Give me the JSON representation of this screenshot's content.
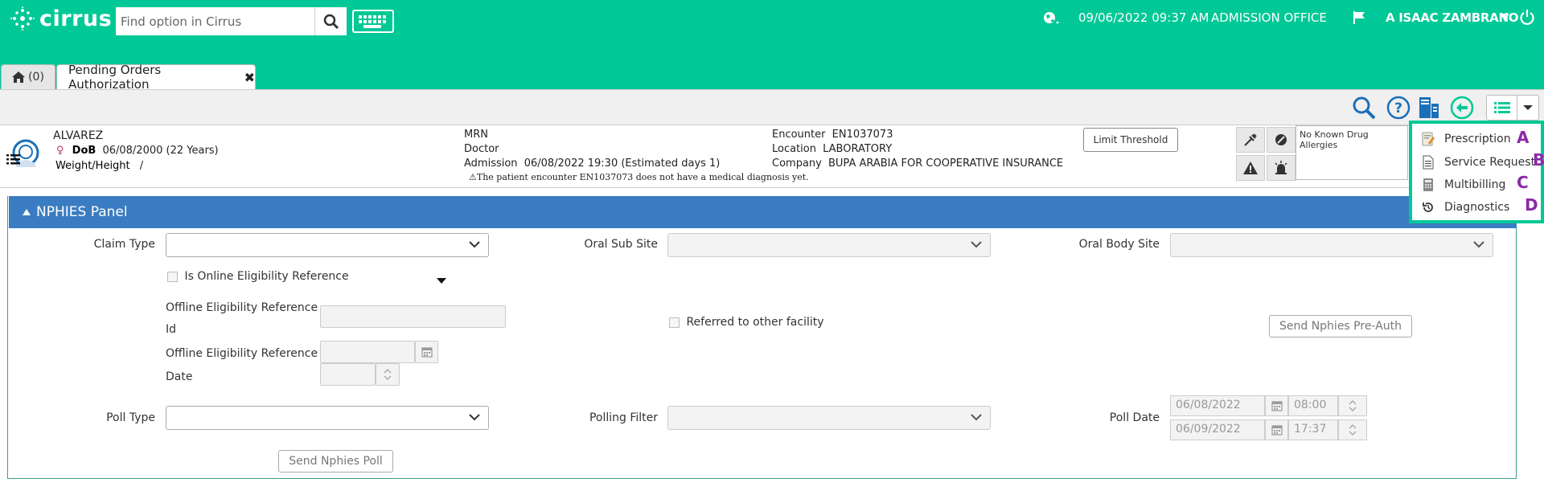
{
  "app": {
    "logo": "cirrus"
  },
  "header": {
    "search_placeholder": "Find option in Cirrus",
    "datetime": "09/06/2022 09:37 AM",
    "office": "ADMISSION OFFICE",
    "username": "A ISAAC ZAMBRANO"
  },
  "tabs": [
    {
      "label": "(0)"
    },
    {
      "label": "Pending Orders Authorization",
      "close": "✖"
    }
  ],
  "patient": {
    "name": "ALVAREZ",
    "dob_label": "DoB",
    "dob_value": "06/08/2000 (22 Years)",
    "wh_label": "Weight/Height",
    "wh_value": "/",
    "mrn_label": "MRN",
    "doctor_label": "Doctor",
    "admission_label": "Admission",
    "admission_value": "06/08/2022 19:30 (Estimated days 1)",
    "warning": "The patient encounter EN1037073 does not have a medical diagnosis yet.",
    "encounter_label": "Encounter",
    "encounter_value": "EN1037073",
    "location_label": "Location",
    "location_value": "LABORATORY",
    "company_label": "Company",
    "company_value": "BUPA ARABIA FOR COOPERATIVE INSURANCE",
    "limit_button": "Limit Threshold",
    "allergies": "No Known Drug Allergies"
  },
  "panel": {
    "title": "NPHIES Panel",
    "claim_type_label": "Claim Type",
    "oral_sub_site_label": "Oral Sub Site",
    "oral_body_site_label": "Oral Body Site",
    "online_elig_label": "Is Online Eligibility Reference",
    "offline_elig_id_label_1": "Offline Eligibility Reference",
    "offline_elig_id_label_2": "Id",
    "offline_elig_date_label_1": "Offline Eligibility Reference",
    "offline_elig_date_label_2": "Date",
    "referred_label": "Referred to other facility",
    "preauth_button": "Send Nphies Pre-Auth",
    "poll_type_label": "Poll Type",
    "polling_filter_label": "Polling Filter",
    "poll_date_label": "Poll Date",
    "poll_date_from": "06/08/2022",
    "poll_time_from": "08:00",
    "poll_date_to": "06/09/2022",
    "poll_time_to": "17:37",
    "poll_button": "Send Nphies Poll"
  },
  "dropdown_menu": {
    "items": [
      {
        "label": "Prescription",
        "letter": "A",
        "icon": "prescription-icon"
      },
      {
        "label": "Service Request",
        "letter": "B",
        "icon": "document-icon"
      },
      {
        "label": "Multibilling",
        "letter": "C",
        "icon": "calculator-icon"
      },
      {
        "label": "Diagnostics",
        "letter": "D",
        "icon": "history-icon"
      }
    ]
  },
  "colors": {
    "brand": "#00c896",
    "panel_header": "#3a7cc1",
    "annotation": "#8a2aa8"
  }
}
